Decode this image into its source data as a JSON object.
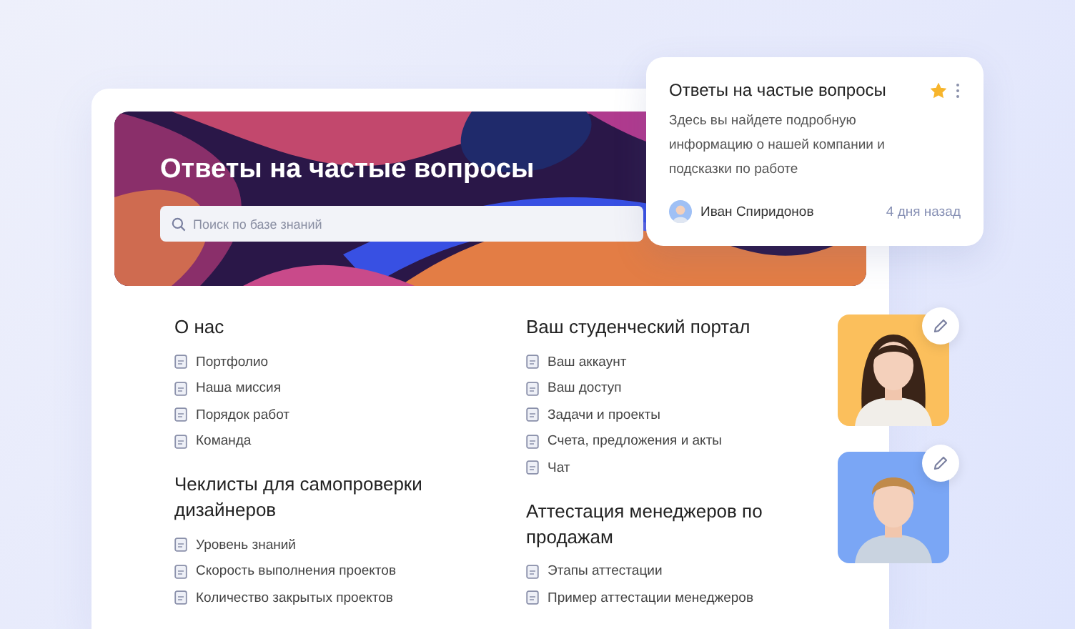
{
  "hero": {
    "title": "Ответы на частые вопросы",
    "search": {
      "placeholder": "Поиск по базе знаний"
    }
  },
  "columns": [
    [
      {
        "title": "О нас",
        "items": [
          "Портфолио",
          "Наша миссия",
          "Порядок работ",
          "Команда"
        ]
      },
      {
        "title": "Чеклисты для самопроверки дизайнеров",
        "items": [
          "Уровень знаний",
          "Скорость выполнения проектов",
          "Количество закрытых проектов"
        ]
      }
    ],
    [
      {
        "title": "Ваш студенческий портал",
        "items": [
          "Ваш аккаунт",
          "Ваш доступ",
          "Задачи и проекты",
          "Счета, предложения и акты",
          "Чат"
        ]
      },
      {
        "title": "Аттестация менеджеров по продажам",
        "items": [
          "Этапы аттестации",
          "Пример аттестации менеджеров"
        ]
      }
    ]
  ],
  "popup": {
    "title": "Ответы на частые вопросы",
    "starred": true,
    "description": "Здесь вы найдете подробную информацию о нашей компании и подсказки по работе",
    "author": "Иван Спиридонов",
    "time": "4 дня назад"
  },
  "photos": [
    {
      "color": "#fbbf5c"
    },
    {
      "color": "#7aa6f5"
    }
  ]
}
